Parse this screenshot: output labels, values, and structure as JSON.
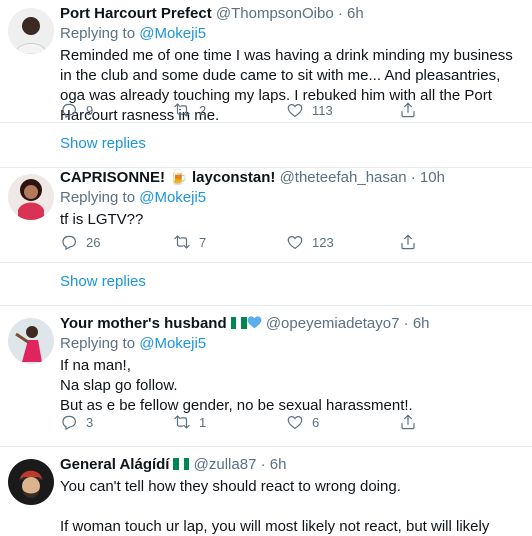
{
  "tweets": [
    {
      "name": "Port Harcourt Prefect",
      "handle": "@ThompsonOibo",
      "time": "6h",
      "reply_label": "Replying to",
      "reply_to": "@Mokeji5",
      "body": "Reminded me of one time I was having a drink minding my business in the club and some dude came to sit with me... And pleasantries, oga was already touching my laps. I rebuked him with all the Port Harcourt rasness  in me.",
      "replies": "9",
      "retweets": "2",
      "likes": "113"
    },
    {
      "name": "CAPRISONNE! 🍺 layconstan!",
      "handle": "@theteefah_hasan",
      "time": "10h",
      "reply_label": "Replying to",
      "reply_to": "@Mokeji5",
      "body": "tf is LGTV??",
      "replies": "26",
      "retweets": "7",
      "likes": "123"
    },
    {
      "name": "Your mother's husband",
      "handle": "@opeyemiadetayo7",
      "time": "6h",
      "reply_label": "Replying to",
      "reply_to": "@Mokeji5",
      "lines": [
        "If na man!,",
        "Na slap go follow.",
        "But as e be fellow gender, no be sexual harassment!."
      ],
      "replies": "3",
      "retweets": "1",
      "likes": "6"
    },
    {
      "name": "General Alágídí",
      "handle": "@zulla87",
      "time": "6h",
      "lines": [
        "You can't tell how they should react to wrong doing.",
        "",
        "If woman touch ur lap, you will most likely not react, but will likely punch a guy who did that in the face"
      ]
    }
  ],
  "show_replies": "Show replies",
  "separator": "·",
  "colors": {
    "link": "#1b95e0",
    "muted": "#5b7083",
    "border": "#e6ecf0",
    "flag_green": "#008751",
    "heart_blue": "#5dadec"
  },
  "icons": [
    "reply-icon",
    "retweet-icon",
    "like-icon",
    "share-icon"
  ]
}
